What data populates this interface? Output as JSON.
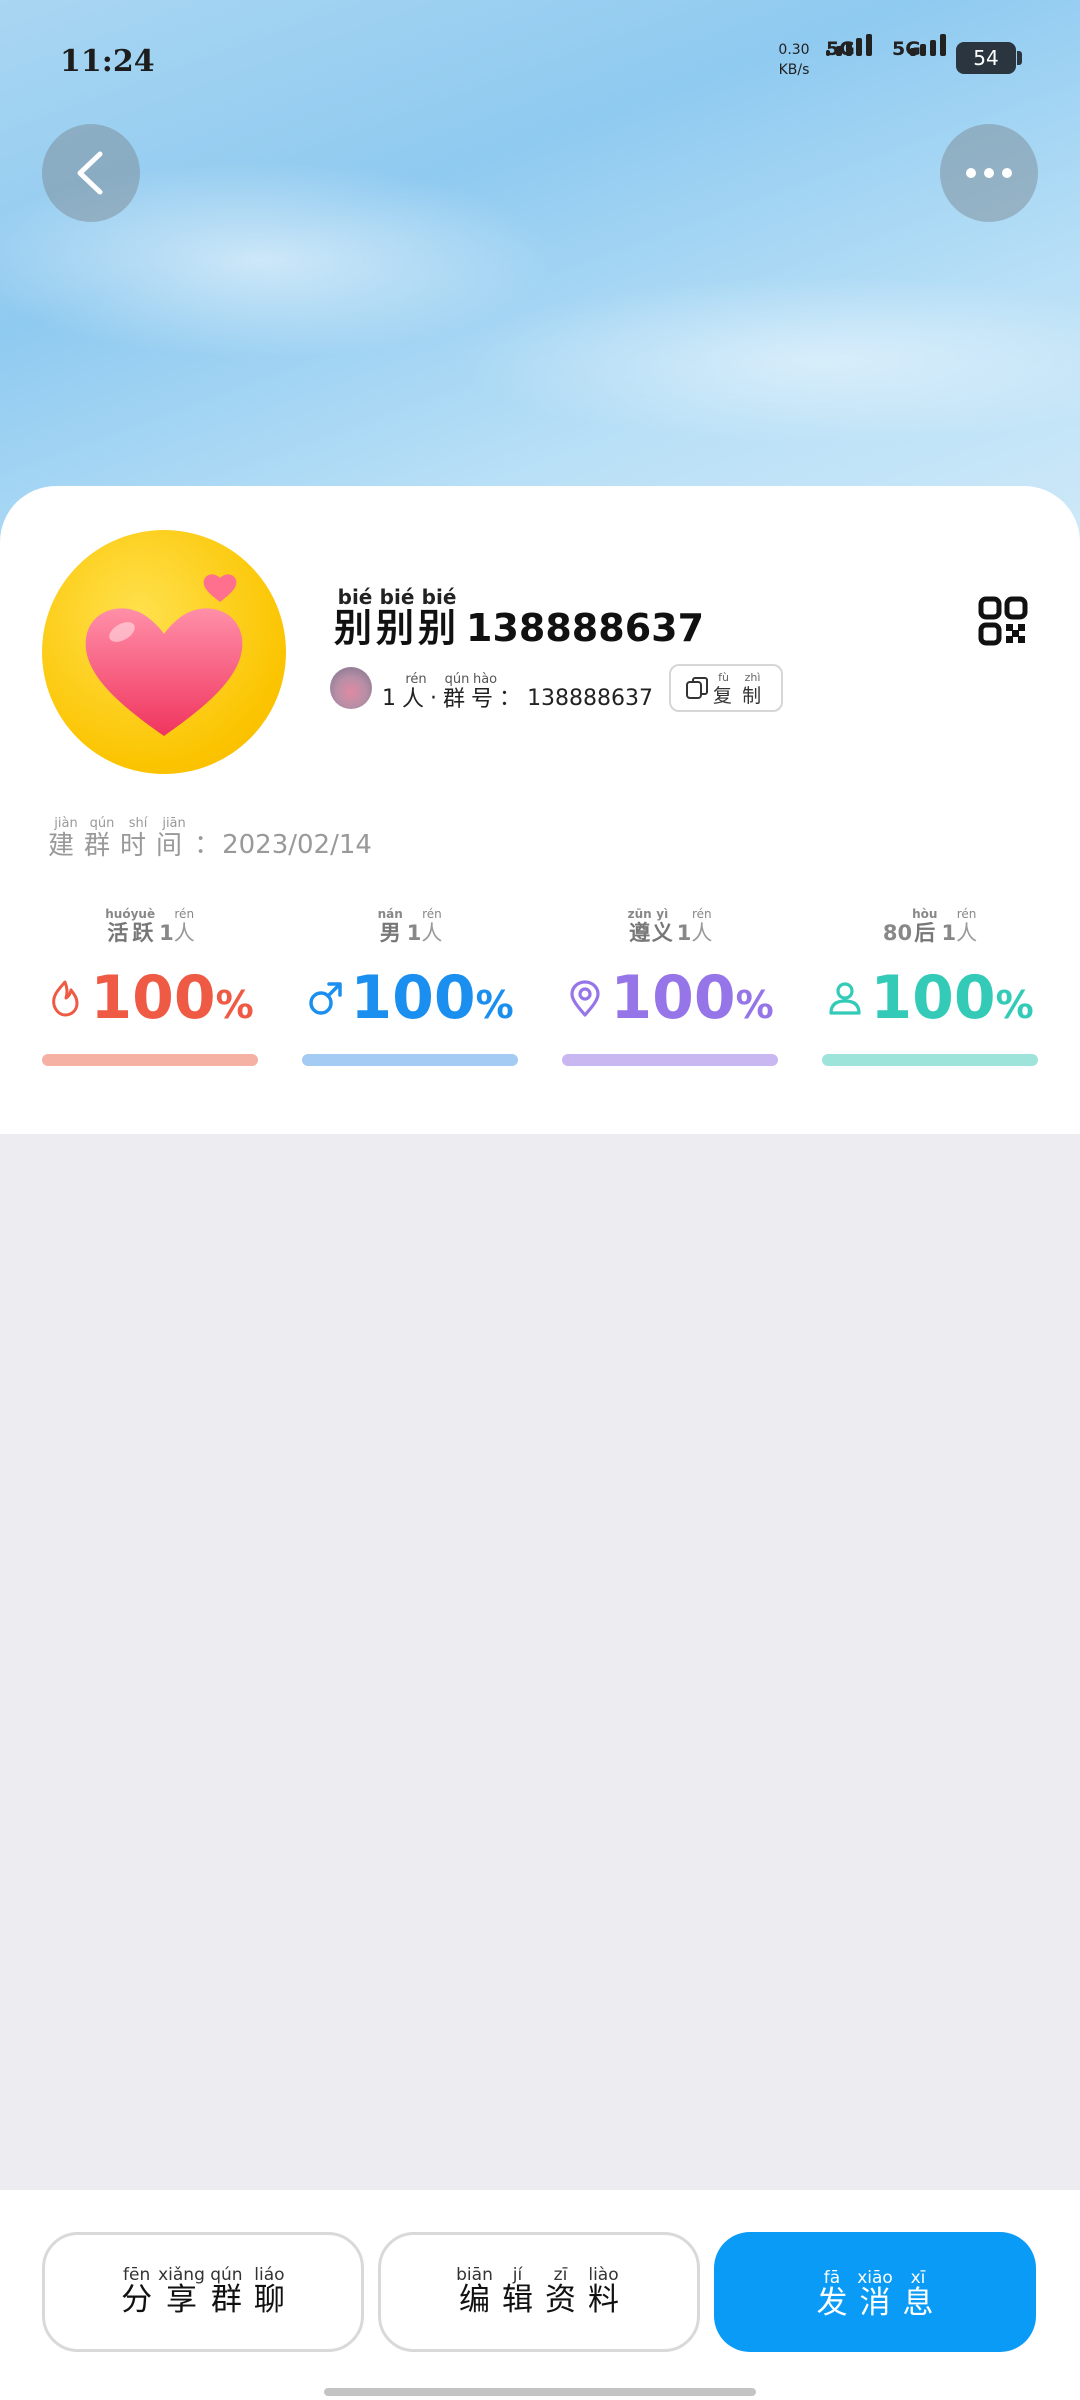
{
  "status_bar": {
    "time": "11:24",
    "net_speed": "0.30",
    "net_unit": "KB/s",
    "sim1": "5G",
    "sim2": "5G",
    "battery": "54"
  },
  "header": {
    "back_icon": "chevron-left-icon",
    "more_icon": "more-horizontal-icon"
  },
  "group": {
    "name_chars": [
      {
        "hz": "别",
        "py": "bié"
      },
      {
        "hz": "别",
        "py": "bié"
      },
      {
        "hz": "别",
        "py": "bié"
      }
    ],
    "name_suffix": "138888637",
    "member_count": "1",
    "member_unit": {
      "hz": "人",
      "py": "rén"
    },
    "separator": "·",
    "id_label": [
      {
        "hz": "群",
        "py": "qún"
      },
      {
        "hz": "号",
        "py": "hào"
      }
    ],
    "colon": "：",
    "id_value": "138888637",
    "copy_label": [
      {
        "hz": "复",
        "py": "fù"
      },
      {
        "hz": "制",
        "py": "zhì"
      }
    ],
    "created_label": [
      {
        "hz": "建",
        "py": "jiàn"
      },
      {
        "hz": "群",
        "py": "qún"
      },
      {
        "hz": "时",
        "py": "shí"
      },
      {
        "hz": "间",
        "py": "jiān"
      }
    ],
    "created_date": "2023/02/14"
  },
  "stats": [
    {
      "label": [
        {
          "hz": "活",
          "py": "huó"
        },
        {
          "hz": "跃",
          "py": "yuè"
        }
      ],
      "count": "1",
      "unit": {
        "hz": "人",
        "py": "rén"
      },
      "value": "100",
      "pct": "%",
      "color": "#ee5a44",
      "bar_color": "#f6b1a5",
      "icon": "flame-icon"
    },
    {
      "label": [
        {
          "hz": "男",
          "py": "nán"
        }
      ],
      "count": "1",
      "unit": {
        "hz": "人",
        "py": "rén"
      },
      "value": "100",
      "pct": "%",
      "color": "#1a8ff0",
      "bar_color": "#a4cbf4",
      "icon": "male-icon"
    },
    {
      "label": [
        {
          "hz": "遵",
          "py": "zūn"
        },
        {
          "hz": "义",
          "py": "yì"
        }
      ],
      "count": "1",
      "unit": {
        "hz": "人",
        "py": "rén"
      },
      "value": "100",
      "pct": "%",
      "color": "#9575e8",
      "bar_color": "#c9b7f2",
      "icon": "location-pin-icon"
    },
    {
      "prefix": "80",
      "label": [
        {
          "hz": "后",
          "py": "hòu"
        }
      ],
      "count": "1",
      "unit": {
        "hz": "人",
        "py": "rén"
      },
      "value": "100",
      "pct": "%",
      "color": "#33cbb8",
      "bar_color": "#9fe4da",
      "icon": "person-icon"
    }
  ],
  "actions": {
    "share": [
      {
        "hz": "分",
        "py": "fēn"
      },
      {
        "hz": "享",
        "py": "xiǎng"
      },
      {
        "hz": "群",
        "py": "qún"
      },
      {
        "hz": "聊",
        "py": "liáo"
      }
    ],
    "edit": [
      {
        "hz": "编",
        "py": "biān"
      },
      {
        "hz": "辑",
        "py": "jí"
      },
      {
        "hz": "资",
        "py": "zī"
      },
      {
        "hz": "料",
        "py": "liào"
      }
    ],
    "send": [
      {
        "hz": "发",
        "py": "fā"
      },
      {
        "hz": "消",
        "py": "xiāo"
      },
      {
        "hz": "息",
        "py": "xī"
      }
    ]
  }
}
